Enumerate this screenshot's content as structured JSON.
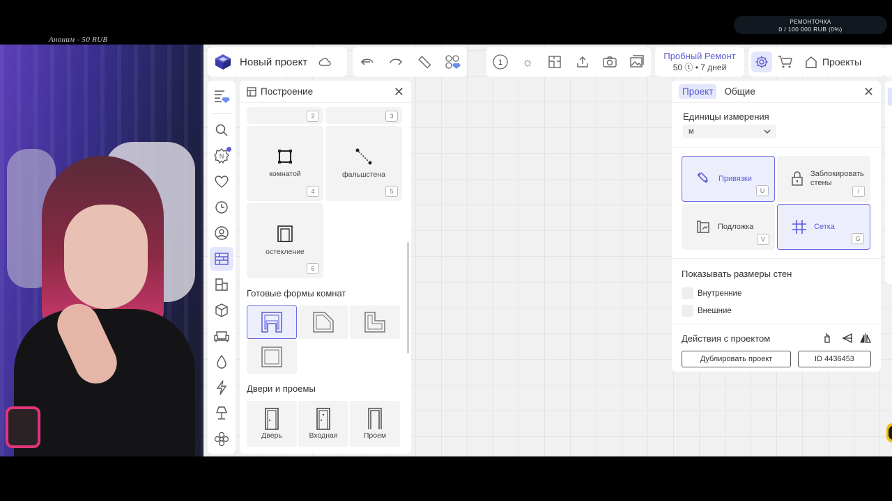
{
  "overlay": {
    "donation_text": "Аноним - 50 RUB",
    "goal_title": "РЕМОНТОЧКА",
    "goal_progress": "0 / 100 000 RUB (0%)"
  },
  "toolbar": {
    "project_title": "Новый проект",
    "trial_title": "Пробный Ремонт",
    "trial_sub": "50 ⓣ • 7 дней",
    "projects_label": "Проекты",
    "step_number": "1"
  },
  "build_panel": {
    "title": "Построение",
    "tools": [
      {
        "label": "",
        "key": "2"
      },
      {
        "label": "",
        "key": "3"
      },
      {
        "label": "комнатой",
        "key": "4"
      },
      {
        "label": "фальшстена",
        "key": "5"
      },
      {
        "label": "остекление",
        "key": "6"
      }
    ],
    "room_shapes_title": "Готовые формы комнат",
    "doors_title": "Двери и проемы",
    "doors": [
      "Дверь",
      "Входная",
      "Проем"
    ]
  },
  "settings_panel": {
    "tab_project": "Проект",
    "tab_general": "Общие",
    "units_label": "Единицы измерения",
    "units_value": "м",
    "toggles": [
      {
        "label": "Привязки",
        "key": "U",
        "active": true
      },
      {
        "label": "Заблокировать стены",
        "key": "/",
        "active": false
      },
      {
        "label": "Подложка",
        "key": "V",
        "active": false
      },
      {
        "label": "Сетка",
        "key": "G",
        "active": true
      }
    ],
    "dims_label": "Показывать размеры стен",
    "dims_inner": "Внутренние",
    "dims_outer": "Внешние",
    "actions_label": "Действия с проектом",
    "duplicate_label": "Дублировать проект",
    "id_label": "ID 4436453"
  },
  "colors": {
    "accent": "#5c5bd6",
    "accent_bg": "#e4e6fb"
  }
}
